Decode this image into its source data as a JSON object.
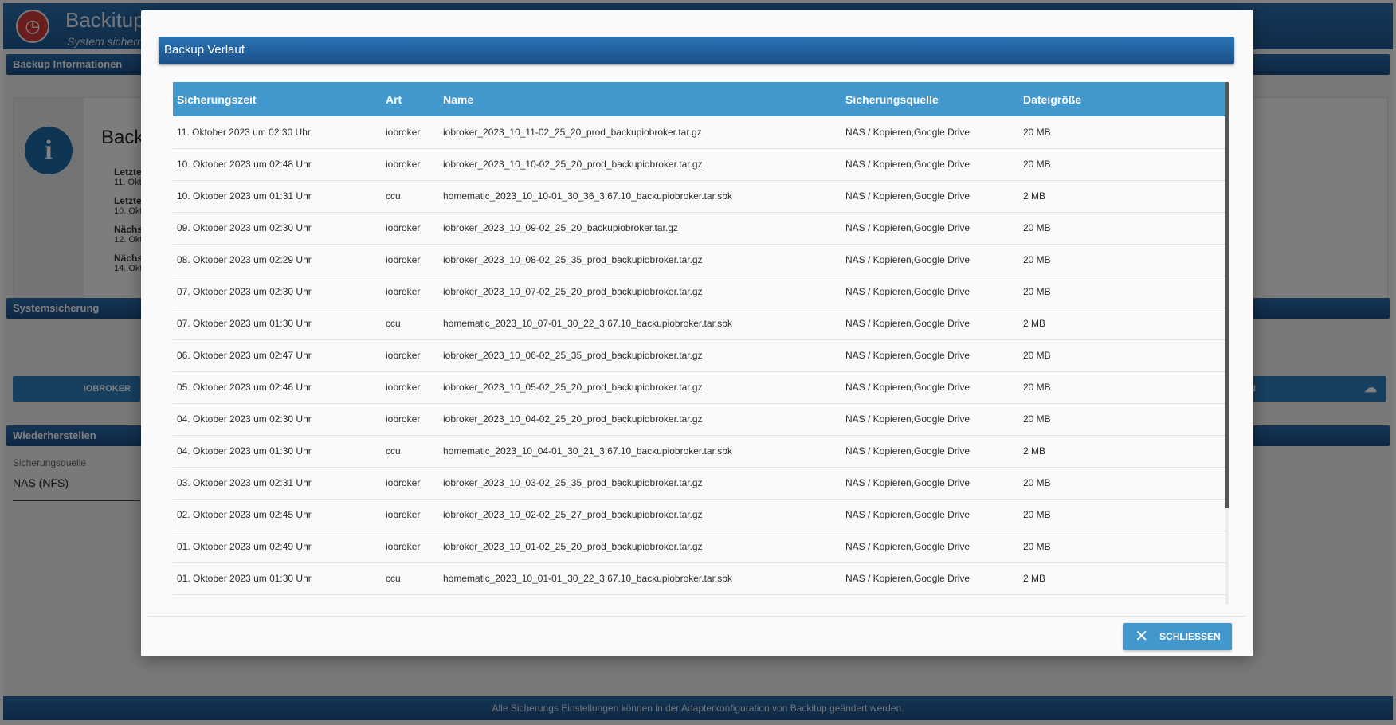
{
  "app": {
    "title": "Backitup",
    "subtitle": "System sichern",
    "help_icons": [
      "graduation-cap-icon",
      "help-icon"
    ],
    "panels": {
      "backup_info": "Backup Informationen",
      "system_backup": "Systemsicherung",
      "restore": "Wiederherstellen"
    },
    "info": {
      "title": "Back",
      "items": [
        {
          "label": "Letzte",
          "value": "11. Okt"
        },
        {
          "label": "Letzte",
          "value": "10. Okt"
        },
        {
          "label": "Nächs",
          "value": "12. Okt"
        },
        {
          "label": "Nächs",
          "value": "14. Okt"
        }
      ]
    },
    "system_backup": {
      "left_button": "IOBROKER",
      "right_button": "RN"
    },
    "restore": {
      "source_label": "Sicherungsquelle",
      "source_value": "NAS (NFS)"
    },
    "footer": "Alle Sicherungs Einstellungen können in der Adapterkonfiguration von Backitup geändert werden."
  },
  "modal": {
    "title": "Backup Verlauf",
    "columns": [
      "Sicherungszeit",
      "Art",
      "Name",
      "Sicherungsquelle",
      "Dateigröße"
    ],
    "rows": [
      [
        "11. Oktober 2023 um 02:30 Uhr",
        "iobroker",
        "iobroker_2023_10_11-02_25_20_prod_backupiobroker.tar.gz",
        "NAS / Kopieren,Google Drive",
        "20 MB"
      ],
      [
        "10. Oktober 2023 um 02:48 Uhr",
        "iobroker",
        "iobroker_2023_10_10-02_25_20_prod_backupiobroker.tar.gz",
        "NAS / Kopieren,Google Drive",
        "20 MB"
      ],
      [
        "10. Oktober 2023 um 01:31 Uhr",
        "ccu",
        "homematic_2023_10_10-01_30_36_3.67.10_backupiobroker.tar.sbk",
        "NAS / Kopieren,Google Drive",
        "2 MB"
      ],
      [
        "09. Oktober 2023 um 02:30 Uhr",
        "iobroker",
        "iobroker_2023_10_09-02_25_20_backupiobroker.tar.gz",
        "NAS / Kopieren,Google Drive",
        "20 MB"
      ],
      [
        "08. Oktober 2023 um 02:29 Uhr",
        "iobroker",
        "iobroker_2023_10_08-02_25_35_prod_backupiobroker.tar.gz",
        "NAS / Kopieren,Google Drive",
        "20 MB"
      ],
      [
        "07. Oktober 2023 um 02:30 Uhr",
        "iobroker",
        "iobroker_2023_10_07-02_25_20_prod_backupiobroker.tar.gz",
        "NAS / Kopieren,Google Drive",
        "20 MB"
      ],
      [
        "07. Oktober 2023 um 01:30 Uhr",
        "ccu",
        "homematic_2023_10_07-01_30_22_3.67.10_backupiobroker.tar.sbk",
        "NAS / Kopieren,Google Drive",
        "2 MB"
      ],
      [
        "06. Oktober 2023 um 02:47 Uhr",
        "iobroker",
        "iobroker_2023_10_06-02_25_35_prod_backupiobroker.tar.gz",
        "NAS / Kopieren,Google Drive",
        "20 MB"
      ],
      [
        "05. Oktober 2023 um 02:46 Uhr",
        "iobroker",
        "iobroker_2023_10_05-02_25_20_prod_backupiobroker.tar.gz",
        "NAS / Kopieren,Google Drive",
        "20 MB"
      ],
      [
        "04. Oktober 2023 um 02:30 Uhr",
        "iobroker",
        "iobroker_2023_10_04-02_25_20_prod_backupiobroker.tar.gz",
        "NAS / Kopieren,Google Drive",
        "20 MB"
      ],
      [
        "04. Oktober 2023 um 01:30 Uhr",
        "ccu",
        "homematic_2023_10_04-01_30_21_3.67.10_backupiobroker.tar.sbk",
        "NAS / Kopieren,Google Drive",
        "2 MB"
      ],
      [
        "03. Oktober 2023 um 02:31 Uhr",
        "iobroker",
        "iobroker_2023_10_03-02_25_35_prod_backupiobroker.tar.gz",
        "NAS / Kopieren,Google Drive",
        "20 MB"
      ],
      [
        "02. Oktober 2023 um 02:45 Uhr",
        "iobroker",
        "iobroker_2023_10_02-02_25_27_prod_backupiobroker.tar.gz",
        "NAS / Kopieren,Google Drive",
        "20 MB"
      ],
      [
        "01. Oktober 2023 um 02:49 Uhr",
        "iobroker",
        "iobroker_2023_10_01-02_25_20_prod_backupiobroker.tar.gz",
        "NAS / Kopieren,Google Drive",
        "20 MB"
      ],
      [
        "01. Oktober 2023 um 01:30 Uhr",
        "ccu",
        "homematic_2023_10_01-01_30_22_3.67.10_backupiobroker.tar.sbk",
        "NAS / Kopieren,Google Drive",
        "2 MB"
      ]
    ],
    "close_label": "SCHLIESSEN",
    "close_icon": "close-icon"
  },
  "colors": {
    "accent": "#4297cc",
    "header_dark": "#1b4f86"
  }
}
